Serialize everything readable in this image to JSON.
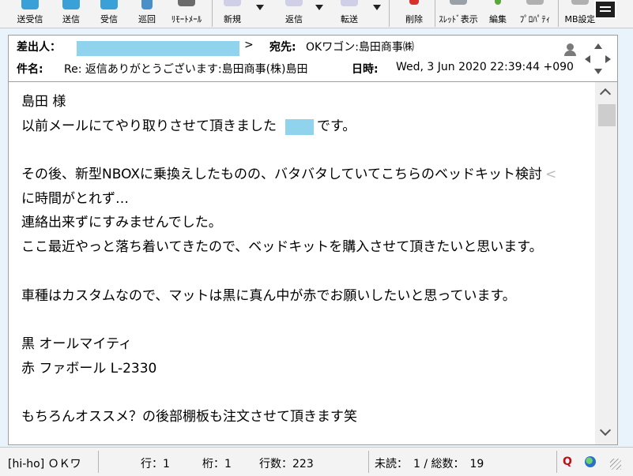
{
  "toolbar": {
    "buttons": [
      {
        "label": "送受信",
        "icon": "send-receive-icon"
      },
      {
        "label": "送信",
        "icon": "send-icon"
      },
      {
        "label": "受信",
        "icon": "receive-icon"
      },
      {
        "label": "巡回",
        "icon": "patrol-icon"
      },
      {
        "label": "ﾘﾓｰﾄﾒｰﾙ",
        "icon": "remote-mail-icon"
      },
      {
        "label": "新規",
        "icon": "new-mail-icon"
      },
      {
        "label": "返信",
        "icon": "reply-icon"
      },
      {
        "label": "転送",
        "icon": "forward-icon"
      },
      {
        "label": "削除",
        "icon": "delete-icon"
      },
      {
        "label": "ｽﾚｯﾄﾞ表示",
        "icon": "thread-view-icon"
      },
      {
        "label": "編集",
        "icon": "edit-icon"
      },
      {
        "label": "ﾌﾟﾛﾊﾟﾃｨ",
        "icon": "properties-icon"
      },
      {
        "label": "MB設定",
        "icon": "mailbox-settings-icon"
      }
    ]
  },
  "header": {
    "from_label": "差出人：",
    "from_suffix": ">",
    "to_label": "宛先:",
    "to_value": "OKワゴン:島田商事㈱",
    "subject_label": "件名:",
    "subject_value": "Re: 返信ありがとうございます:島田商事(株)島田",
    "date_label": "日時:",
    "date_value": "Wed, 3 Jun 2020 22:39:44 +090"
  },
  "body": {
    "lines": [
      "島田 様",
      "以前メールにてやり取りさせて頂きました　　　です。",
      "",
      "その後、新型NBOXに乗換えしたものの、バタバタしていてこちらのベッドキット検討",
      "に時間がとれず…",
      "連絡出来ずにすみませんでした。",
      "ここ最近やっと落ち着いてきたので、ベッドキットを購入させて頂きたいと思います。",
      "",
      "車種はカスタムなので、マットは黒に真ん中が赤でお願いしたいと思っています。",
      "",
      "黒 オールマイティ",
      "赤 ファボール L-2330",
      "",
      "もちろんオススメ？の後部棚板も注文させて頂きます笑"
    ],
    "wrap_marker": "<"
  },
  "status": {
    "mailbox": "[hi-ho] ＯＫワ",
    "row": "行：1",
    "col": "桁：1",
    "line_count": "行数：223",
    "unread": "未読：　1 / 総数：　19",
    "q_icon": "Q"
  },
  "colors": {
    "toolbar_bg": "#f3f3f3",
    "redaction": "#8fd3ec",
    "window_bg": "#e8f3fb"
  }
}
